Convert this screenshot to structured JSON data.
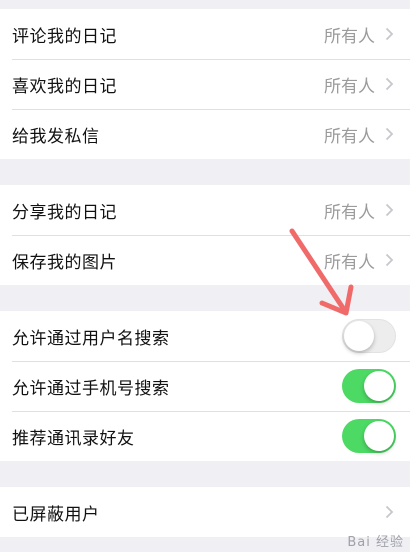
{
  "groups": [
    {
      "rows": [
        {
          "label": "评论我的日记",
          "value": "所有人"
        },
        {
          "label": "喜欢我的日记",
          "value": "所有人"
        },
        {
          "label": "给我发私信",
          "value": "所有人"
        }
      ]
    },
    {
      "rows": [
        {
          "label": "分享我的日记",
          "value": "所有人"
        },
        {
          "label": "保存我的图片",
          "value": "所有人"
        }
      ]
    },
    {
      "rows": [
        {
          "label": "允许通过用户名搜索",
          "toggle": false
        },
        {
          "label": "允许通过手机号搜索",
          "toggle": true
        },
        {
          "label": "推荐通讯录好友",
          "toggle": true
        }
      ]
    },
    {
      "rows": [
        {
          "label": "已屏蔽用户"
        }
      ]
    }
  ],
  "colors": {
    "toggle_on": "#4cd964",
    "arrow": "#f06a6a",
    "background": "#efeff4"
  },
  "annotation": {
    "icon": "red-arrow-icon"
  },
  "watermark": {
    "text": "Bai 经验"
  }
}
